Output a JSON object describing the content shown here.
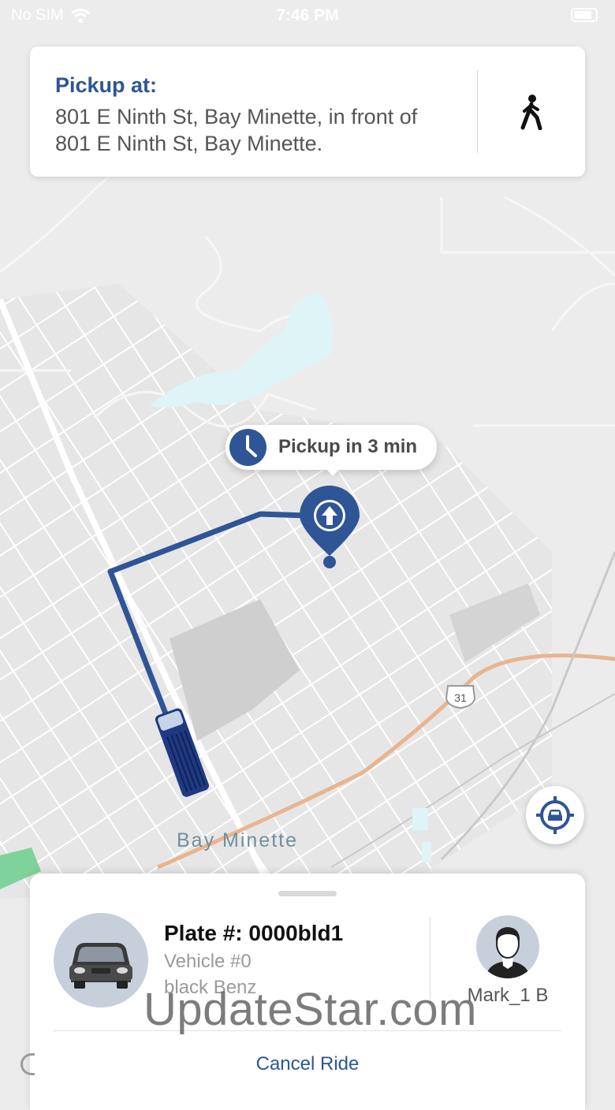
{
  "status_bar": {
    "carrier": "No SIM",
    "time": "7:46 PM"
  },
  "pickup": {
    "title": "Pickup at:",
    "address": "801 E Ninth St, Bay Minette, in front of 801 E Ninth St, Bay Minette.",
    "walk_icon": "walking-person-icon"
  },
  "map": {
    "eta_label": "Pickup in 3 min",
    "town_label": "Bay Minette",
    "highway_shield": "31",
    "route_color": "#2f5596",
    "locate_icon": "locate-vehicle-icon"
  },
  "ride": {
    "plate": "Plate #: 0000bld1",
    "vehicle": "Vehicle #0",
    "vehicle_desc": "black Benz",
    "driver_name": "Mark_1 B",
    "cancel_label": "Cancel Ride"
  },
  "watermark": "UpdateStar.com",
  "colors": {
    "brand_blue": "#2f5596",
    "map_bg": "#ececec",
    "road": "#ffffff",
    "highway": "#e9b48f",
    "water": "#dff4f6"
  }
}
